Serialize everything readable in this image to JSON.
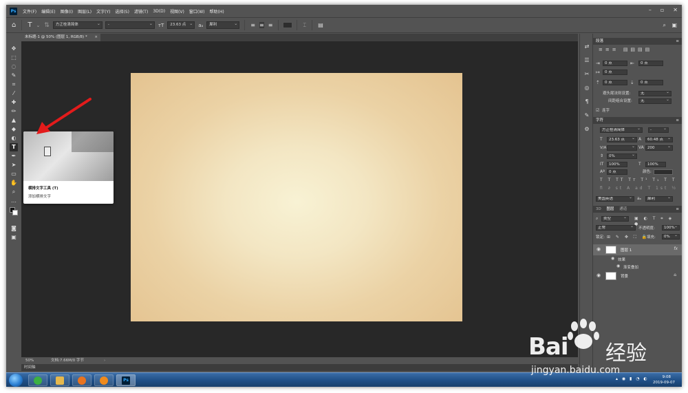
{
  "menubar": {
    "logo": "Ps",
    "items": [
      "文件(F)",
      "编辑(E)",
      "图像(I)",
      "图层(L)",
      "文字(Y)",
      "选择(S)",
      "滤镜(T)",
      "3D(D)",
      "视图(V)",
      "窗口(W)",
      "帮助(H)"
    ],
    "window_controls": [
      "–",
      "▫",
      "✕"
    ]
  },
  "options_bar": {
    "font_family": "方正桂清简体",
    "font_style": "-",
    "font_size": "23.63 点",
    "antialias": "犀利",
    "text_color": "#2d2d2d"
  },
  "document": {
    "tab_label": "未标题-1 @ 50% (图层 1, RGB/8) *",
    "tab_close": "×",
    "canvas_colors": [
      "#f8f2d4",
      "#e4c390"
    ]
  },
  "tooltip": {
    "title": "横排文字工具 (T)",
    "description": "添加横排文字"
  },
  "statusbar": {
    "zoom": "50%",
    "doc_size": "文档:7.66M/0 字节",
    "timeline": "时间轴"
  },
  "paragraph_panel": {
    "title": "段落",
    "indent_left": "0 点",
    "indent_right": "0 点",
    "indent_first": "0 点",
    "space_before": "0 点",
    "space_after": "0 点",
    "avoid_label": "避头尾法则设置:",
    "avoid_value": "无",
    "spacing_label": "间距组合设置:",
    "spacing_value": "无",
    "hyphenate_label": "连字"
  },
  "character_panel": {
    "title": "字符",
    "font_family": "方正桂清简体",
    "font_style": "-",
    "font_size": "23.63 点",
    "leading": "60.48 点",
    "kerning": "V/A",
    "tracking": "200",
    "scale_pct": "0%",
    "vertical_scale": "100%",
    "horizontal_scale": "100%",
    "baseline": "0 点",
    "color_label": "颜色:",
    "language": "美国英语",
    "antialias": "犀利",
    "color": "#2d2d2d"
  },
  "layers_panel": {
    "tabs": [
      "3D",
      "图层",
      "通道"
    ],
    "filter": "类型",
    "blend_mode": "正常",
    "opacity_label": "不透明度:",
    "opacity": "100%",
    "lock_label": "锁定:",
    "fill_label": "填充:",
    "fill": "0%",
    "layers": [
      {
        "name": "图层 1",
        "selected": true,
        "fx": "fx"
      },
      {
        "name": "效果"
      },
      {
        "name": "渐变叠加"
      },
      {
        "name": "背景",
        "locked": true
      }
    ]
  },
  "taskbar": {
    "time": "9:08",
    "date": "2019-09-07",
    "ps_label": "Ps"
  },
  "watermark": {
    "brand": "Bai",
    "brand_tail": "经验",
    "url": "jingyan.baidu.com"
  }
}
